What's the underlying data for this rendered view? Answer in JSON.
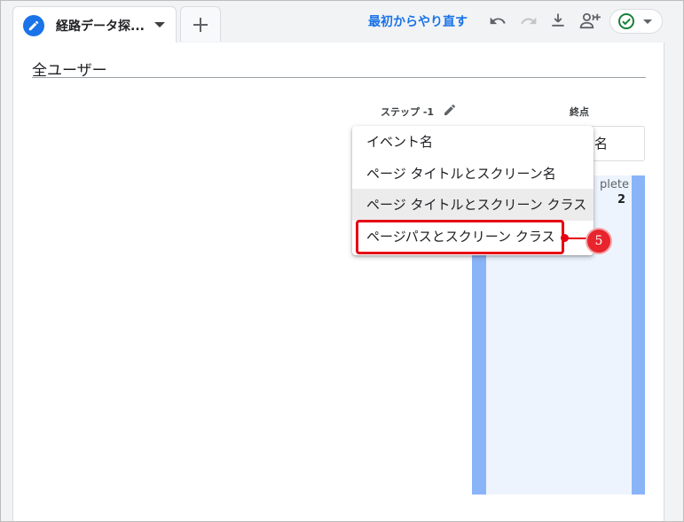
{
  "tab": {
    "title": "経路データ探...",
    "add_label": "+"
  },
  "toolbar": {
    "reset_label": "最初からやり直す",
    "icons": [
      "undo-icon",
      "redo-icon",
      "download-icon",
      "share-user-icon",
      "check-circle-icon"
    ]
  },
  "segment": {
    "title": "全ユーザー"
  },
  "columns": {
    "step_label": "ステップ -1",
    "end_label": "終点",
    "end_select_value": "名"
  },
  "chart_node": {
    "name": "plete",
    "count": "2"
  },
  "menu": {
    "items": [
      {
        "label": "イベント名"
      },
      {
        "label": "ページ タイトルとスクリーン名"
      },
      {
        "label": "ページ タイトルとスクリーン クラス"
      },
      {
        "label": "ページパスとスクリーン クラス"
      }
    ],
    "hovered_index": 2,
    "selected_index": 3
  },
  "callout": {
    "number": "5"
  },
  "colors": {
    "accent_blue": "#1a73e8",
    "bar_blue": "#8ab4f8",
    "annotation_red": "#e60012",
    "success_green": "#188038"
  }
}
